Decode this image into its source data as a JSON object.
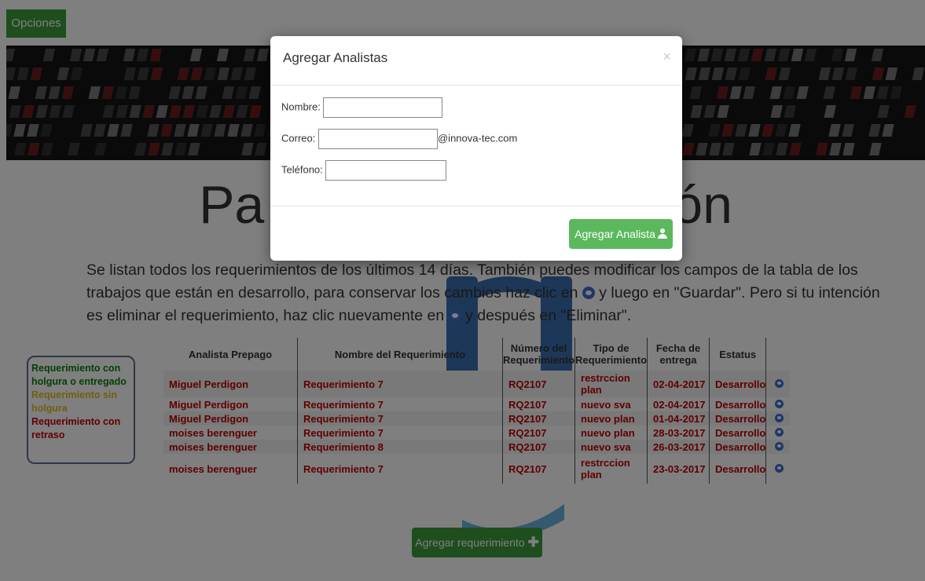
{
  "topbar": {
    "options_label": "Opciones"
  },
  "hero": {
    "title_partial": "Pa",
    "title_end": "ón"
  },
  "intro": {
    "part1": "Se listan todos los requerimientos de los últimos 14 días. También puedes modificar los campos de la tabla de los trabajos que están en desarrollo, para conservar los cambios haz clic en ",
    "part2": " y luego en \"Guardar\". Pero si tu intención es eliminar el requerimiento, haz clic nuevamente en ",
    "part3": " y después en \"Eliminar\"."
  },
  "legend": {
    "green": "Requerimiento con holgura o entregado",
    "yellow": "Requerimiento sin holgura",
    "red": "Requerimiento con retraso",
    "colors": {
      "green": "#0d7d0d",
      "yellow": "#e3bc1c",
      "red": "#c00000"
    }
  },
  "table": {
    "headers": [
      "Analista Prepago",
      "Nombre del Requerimiento",
      "Número del Requerimiento",
      "Tipo de Requerimiento",
      "Fecha de entrega",
      "Estatus"
    ],
    "rows": [
      [
        "Miguel Perdigon",
        "Requerimiento 7",
        "RQ2107",
        "restrccion plan",
        "02-04-2017",
        "Desarrollo"
      ],
      [
        "Miguel Perdigon",
        "Requerimiento 7",
        "RQ2107",
        "nuevo sva",
        "02-04-2017",
        "Desarrollo"
      ],
      [
        "Miguel Perdigon",
        "Requerimiento 7",
        "RQ2107",
        "nuevo plan",
        "01-04-2017",
        "Desarrollo"
      ],
      [
        "moises berenguer",
        "Requerimiento 7",
        "RQ2107",
        "nuevo plan",
        "28-03-2017",
        "Desarrollo"
      ],
      [
        "moises berenguer",
        "Requerimiento 8",
        "RQ2107",
        "nuevo sva",
        "26-03-2017",
        "Desarrollo"
      ],
      [
        "moises berenguer",
        "Requerimiento 7",
        "RQ2107",
        "restrccion plan",
        "23-03-2017",
        "Desarrollo"
      ]
    ],
    "row_icon": "eye-icon"
  },
  "actions": {
    "add_requirement_label": "Agregar requerimiento"
  },
  "modal": {
    "title": "Agregar Analistas",
    "close_glyph": "×",
    "name_label": "Nombre:",
    "name_value": "",
    "email_label": "Correo:",
    "email_value": "",
    "email_suffix": "@innova-tec.com",
    "phone_label": "Teléfono:",
    "phone_value": "",
    "submit_label": "Agregar Analista"
  }
}
